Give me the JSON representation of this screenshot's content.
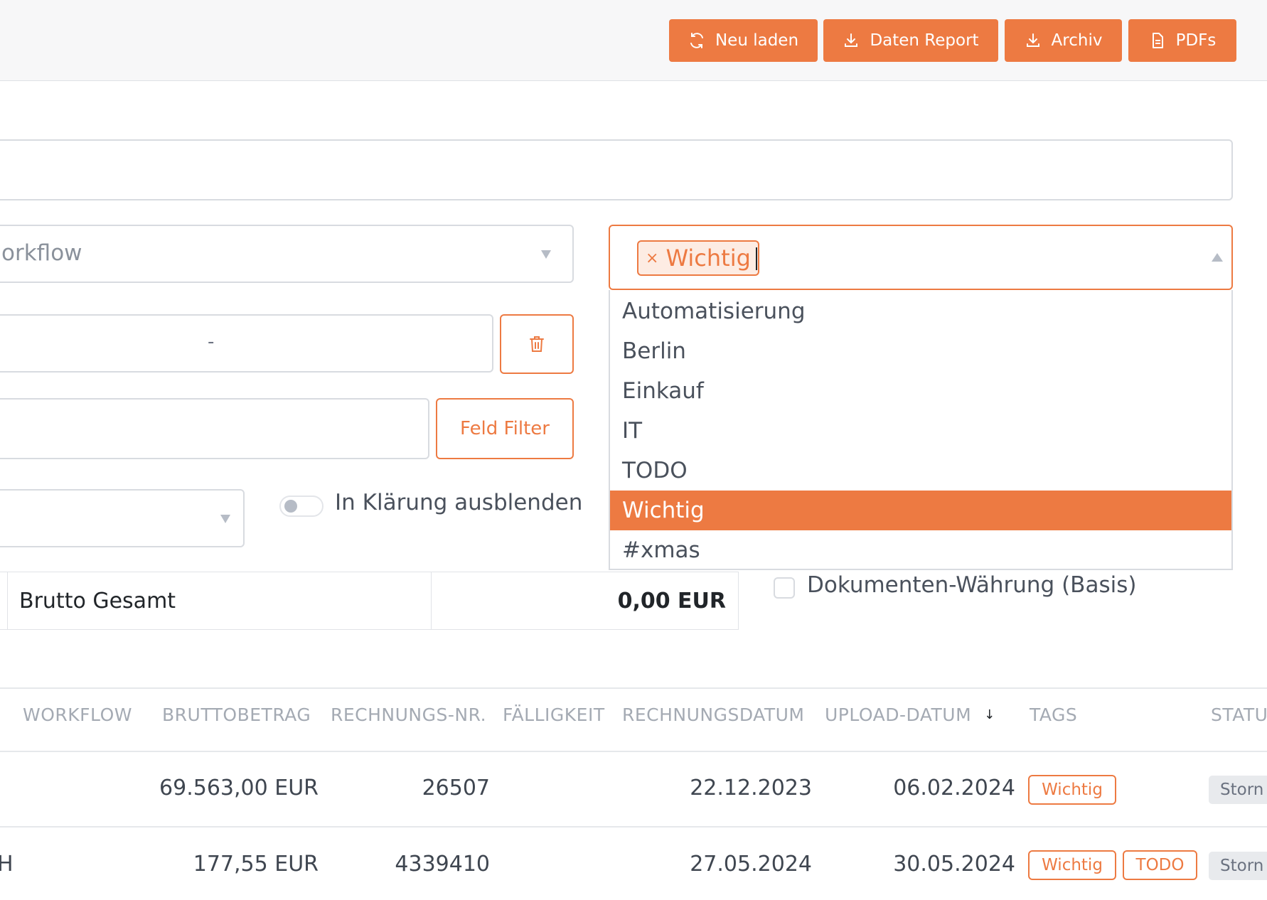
{
  "toolbar": {
    "reload_label": "Neu laden",
    "report_label": "Daten Report",
    "archive_label": "Archiv",
    "pdfs_label": "PDFs"
  },
  "filters": {
    "workflow_placeholder": "orkflow",
    "date_range_separator": "-",
    "field_filter_label": "Feld Filter",
    "hide_clarification_label": "In Klärung ausblenden",
    "tags": {
      "selected": [
        "Wichtig"
      ],
      "options": [
        "Automatisierung",
        "Berlin",
        "Einkauf",
        "IT",
        "TODO",
        "Wichtig",
        "#xmas"
      ],
      "highlighted": "Wichtig"
    }
  },
  "summary": {
    "label": "Brutto Gesamt",
    "value": "0,00 EUR",
    "currency_toggle_label": "Dokumenten-Währung (Basis)"
  },
  "table": {
    "headers": {
      "workflow": "WORKFLOW",
      "gross": "BRUTTOBETRAG",
      "invoice_no": "RECHNUNGS-NR.",
      "due": "FÄLLIGKEIT",
      "invoice_date": "RECHNUNGSDATUM",
      "upload_date": "UPLOAD-DATUM",
      "sort_indicator": "↓",
      "tags": "TAGS",
      "status": "STATU"
    },
    "rows": [
      {
        "workflow": "",
        "gross": "69.563,00 EUR",
        "invoice_no": "26507",
        "due": "",
        "invoice_date": "22.12.2023",
        "upload_date": "06.02.2024",
        "tags": [
          "Wichtig"
        ],
        "status": "Storn"
      },
      {
        "workflow": "H",
        "gross": "177,55 EUR",
        "invoice_no": "4339410",
        "due": "",
        "invoice_date": "27.05.2024",
        "upload_date": "30.05.2024",
        "tags": [
          "Wichtig",
          "TODO"
        ],
        "status": "Storn"
      }
    ]
  },
  "colors": {
    "accent": "#ed7a42",
    "border": "#d8dbe0",
    "muted_text": "#a4aab3"
  }
}
